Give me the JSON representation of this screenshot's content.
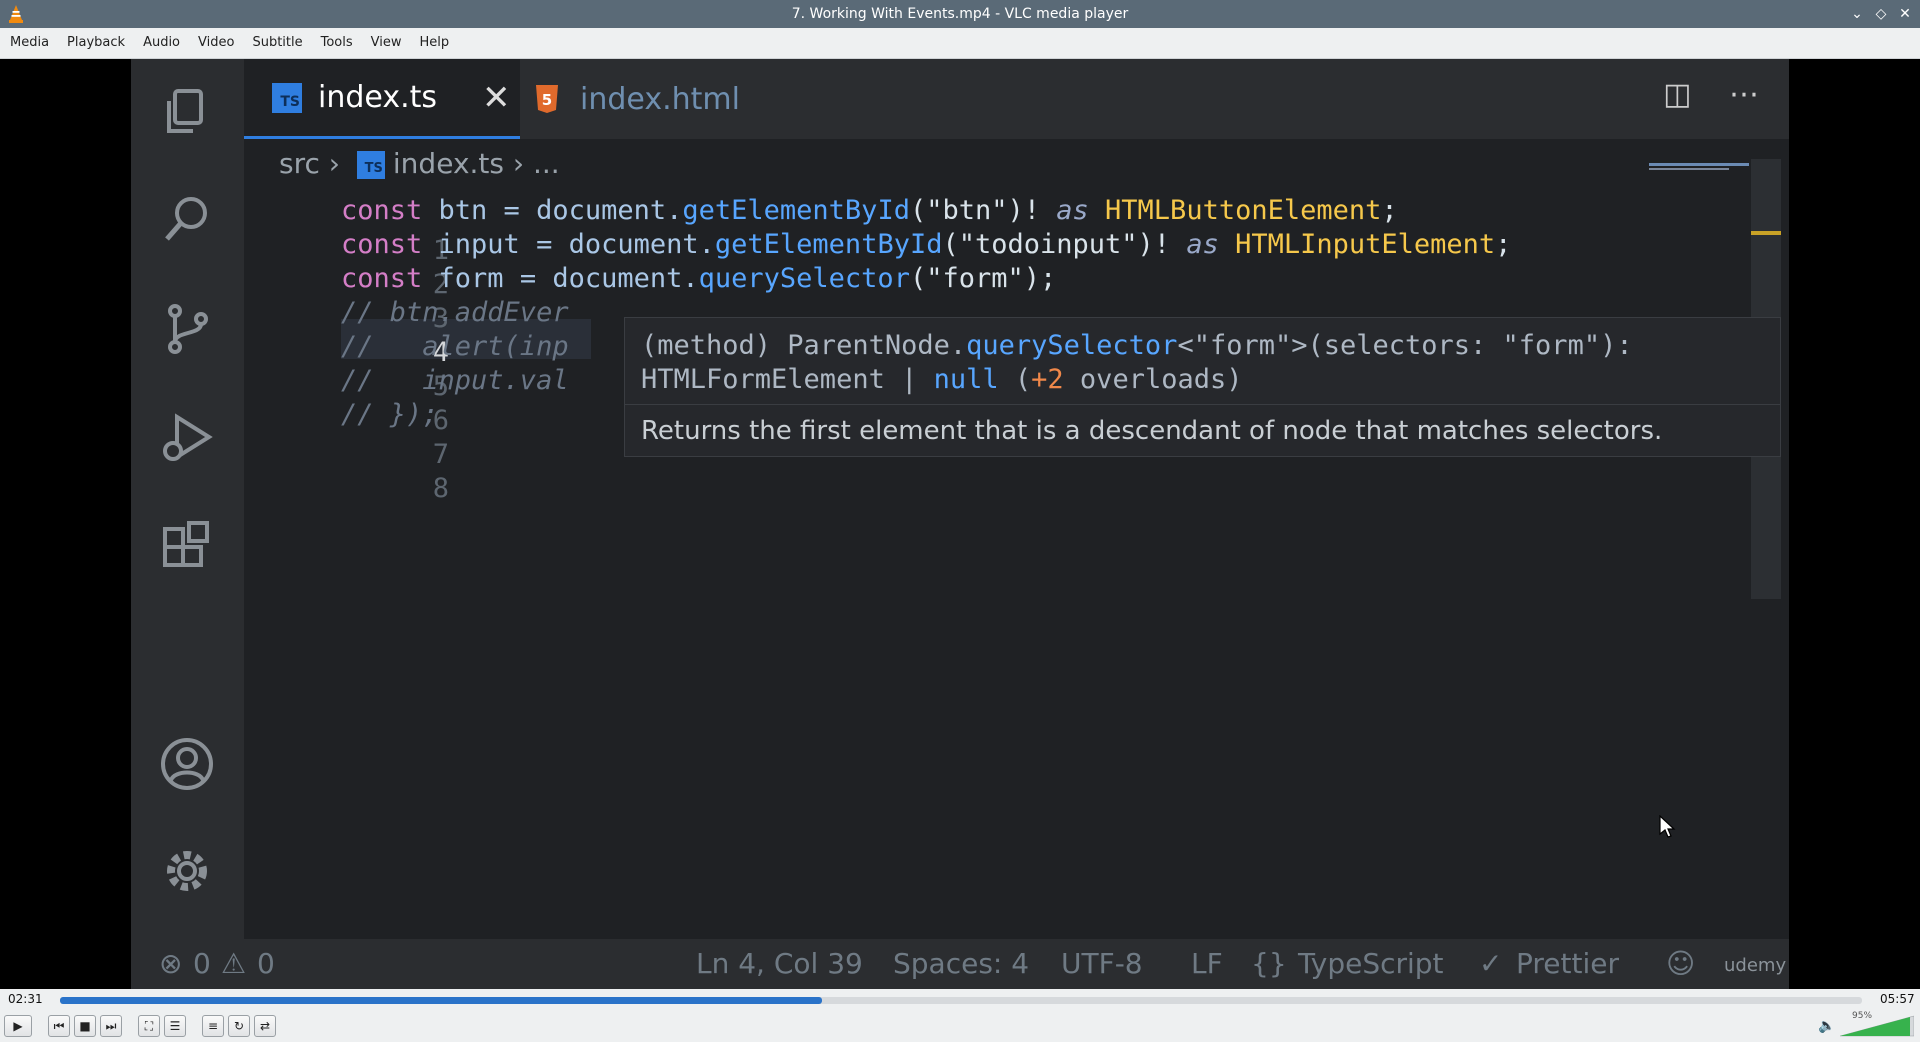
{
  "window": {
    "title": "7. Working With Events.mp4 - VLC media player"
  },
  "menu": [
    "Media",
    "Playback",
    "Audio",
    "Video",
    "Subtitle",
    "Tools",
    "View",
    "Help"
  ],
  "editor": {
    "tabs": [
      {
        "label": "index.ts",
        "badge": "TS"
      },
      {
        "label": "index.html",
        "badge": "5"
      }
    ],
    "breadcrumb": {
      "folder": "src",
      "file": "index.ts",
      "more": "..."
    },
    "line_numbers": [
      "1",
      "2",
      "3",
      "4",
      "5",
      "6",
      "7",
      "8"
    ],
    "code": {
      "l1": {
        "kw": "const",
        "id": " btn = document.",
        "fn": "getElementById",
        "s1": "(\"btn\")! ",
        "as": "as",
        "ty": " HTMLButtonElement",
        "end": ";"
      },
      "l2": {
        "kw": "const",
        "id": " input = document.",
        "fn": "getElementById",
        "s1": "(\"todoinput\")! ",
        "as": "as",
        "ty": " HTMLInputElement",
        "end": ";"
      },
      "l3": {
        "kw": "const",
        "id": " form = document.",
        "fn": "querySelector",
        "s1": "(\"form\");"
      },
      "l4": "// btn.addEver",
      "l5": "//   alert(inp",
      "l6": "//   input.val",
      "l7": "// });"
    },
    "hover": {
      "sig1_a": "(method) ParentNode.",
      "sig1_fn": "querySelector",
      "sig1_b": "<\"form\">(selectors: \"form\"):",
      "sig2_a": "HTMLFormElement | ",
      "sig2_null": "null",
      "sig2_b": " (",
      "sig2_n": "+2",
      "sig2_c": " overloads)",
      "doc": "Returns the first element that is a descendant of node that matches selectors."
    },
    "status": {
      "errors": "0",
      "warnings": "0",
      "position": "Ln 4, Col 39",
      "spaces": "Spaces: 4",
      "encoding": "UTF-8",
      "eol": "LF",
      "language": "TypeScript",
      "formatter": "Prettier",
      "watermark": "udemy"
    }
  },
  "player": {
    "elapsed": "02:31",
    "total": "05:57",
    "progress_fraction": 0.423,
    "volume": "95%"
  },
  "colors": {
    "titlebar": "#5a6a77",
    "accent": "#2a73c9",
    "ts_blue": "#2f7ee0"
  }
}
